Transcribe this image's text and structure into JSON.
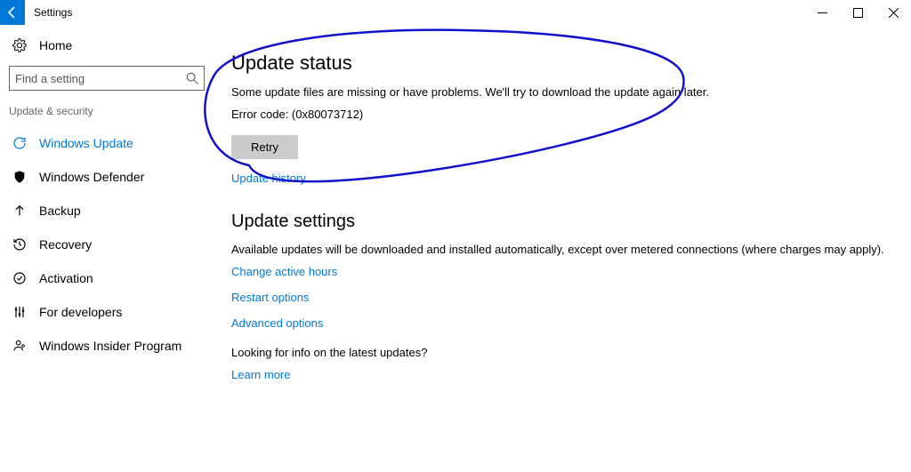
{
  "titlebar": {
    "title": "Settings"
  },
  "sidebar": {
    "home": "Home",
    "search_placeholder": "Find a setting",
    "section_label": "Update & security",
    "items": [
      {
        "label": "Windows Update"
      },
      {
        "label": "Windows Defender"
      },
      {
        "label": "Backup"
      },
      {
        "label": "Recovery"
      },
      {
        "label": "Activation"
      },
      {
        "label": "For developers"
      },
      {
        "label": "Windows Insider Program"
      }
    ]
  },
  "main": {
    "status_heading": "Update status",
    "status_msg": "Some update files are missing or have problems. We'll try to download the update again later.",
    "error_code": "Error code: (0x80073712)",
    "retry_label": "Retry",
    "history_link": "Update history",
    "settings_heading": "Update settings",
    "settings_desc": "Available updates will be downloaded and installed automatically, except over metered connections (where charges may apply).",
    "links": {
      "active_hours": "Change active hours",
      "restart": "Restart options",
      "advanced": "Advanced options"
    },
    "footer_q": "Looking for info on the latest updates?",
    "learn_more": "Learn more"
  }
}
